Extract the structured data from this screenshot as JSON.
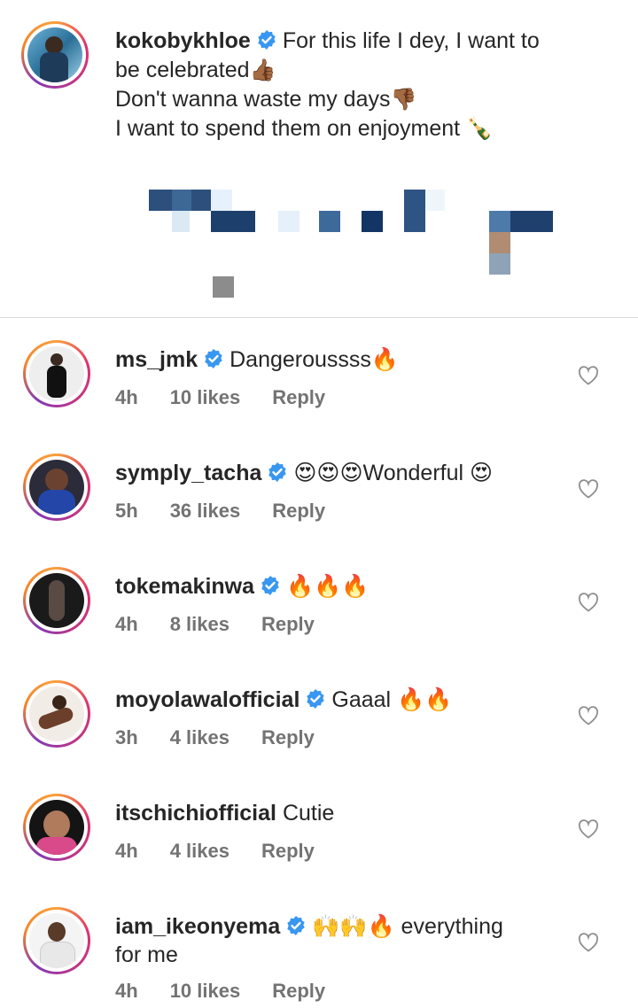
{
  "caption": {
    "username": "kokobykhloe",
    "line1": "For this life I dey, I want to",
    "line2": "be celebrated",
    "line2_emoji": "👍🏾",
    "line3": "Don't wanna waste my days",
    "line3_emoji": "👎🏾",
    "line4": "I want to spend them on enjoyment",
    "line4_emoji": "🍾"
  },
  "comments": [
    {
      "username": "ms_jmk",
      "verified": true,
      "text": "Dangeroussss🔥",
      "time": "4h",
      "likes": "10 likes",
      "reply": "Reply"
    },
    {
      "username": "symply_tacha",
      "verified": true,
      "text": "😍😍😍Wonderful 😍",
      "time": "5h",
      "likes": "36 likes",
      "reply": "Reply"
    },
    {
      "username": "tokemakinwa",
      "verified": true,
      "text": "🔥🔥🔥",
      "time": "4h",
      "likes": "8 likes",
      "reply": "Reply"
    },
    {
      "username": "moyolawalofficial",
      "verified": true,
      "text": "Gaaal 🔥🔥",
      "time": "3h",
      "likes": "4 likes",
      "reply": "Reply"
    },
    {
      "username": "itschichiofficial",
      "verified": false,
      "text": "Cutie",
      "time": "4h",
      "likes": "4 likes",
      "reply": "Reply"
    },
    {
      "username": "iam_ikeonyema",
      "verified": true,
      "text": "🙌🙌🔥 everything",
      "text2": "for me",
      "time": "4h",
      "likes": "10 likes",
      "reply": "Reply"
    }
  ],
  "colors": {
    "verified": "#3897f0",
    "meta": "#737373",
    "text": "#262626",
    "divider": "#dbdbdb"
  },
  "icons": [
    "verified-badge-icon",
    "heart-icon"
  ]
}
